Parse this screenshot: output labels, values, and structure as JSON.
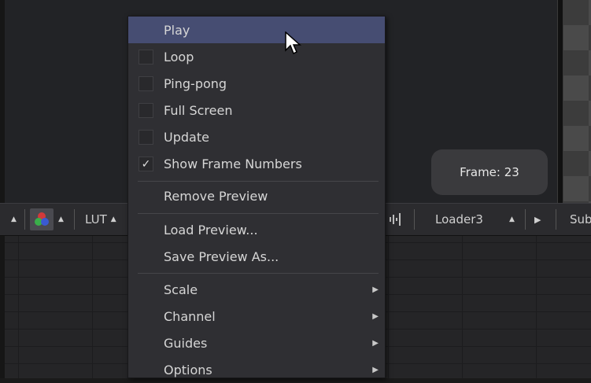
{
  "viewer": {
    "frame_label": "Frame: 23"
  },
  "toolbar": {
    "lut_label": "LUT",
    "loader_label": "Loader3",
    "sub_label": "Sub"
  },
  "context_menu": {
    "items": [
      {
        "label": "Play",
        "type": "action",
        "highlighted": true
      },
      {
        "label": "Loop",
        "type": "checkbox",
        "checked": false
      },
      {
        "label": "Ping-pong",
        "type": "checkbox",
        "checked": false
      },
      {
        "label": "Full Screen",
        "type": "checkbox",
        "checked": false
      },
      {
        "label": "Update",
        "type": "checkbox",
        "checked": false
      },
      {
        "label": "Show Frame Numbers",
        "type": "checkbox",
        "checked": true,
        "check_glyph": "✓"
      },
      {
        "label": "Remove Preview",
        "type": "action"
      },
      {
        "label": "Load Preview...",
        "type": "action"
      },
      {
        "label": "Save Preview As...",
        "type": "action"
      },
      {
        "label": "Scale",
        "type": "submenu"
      },
      {
        "label": "Channel",
        "type": "submenu"
      },
      {
        "label": "Guides",
        "type": "submenu"
      },
      {
        "label": "Options",
        "type": "submenu"
      }
    ]
  },
  "icons": {
    "submenu_arrow": "▶",
    "up_arrow": "▲",
    "play_arrow": "▶",
    "cursor": "mouse-pointer-icon"
  },
  "colors": {
    "highlight": "#464d72",
    "menu_bg": "#2f2f33",
    "viewer_bg": "#222326",
    "rgb_red": "#d23a3a",
    "rgb_green": "#3aae4a",
    "rgb_blue": "#3a5ad2"
  }
}
